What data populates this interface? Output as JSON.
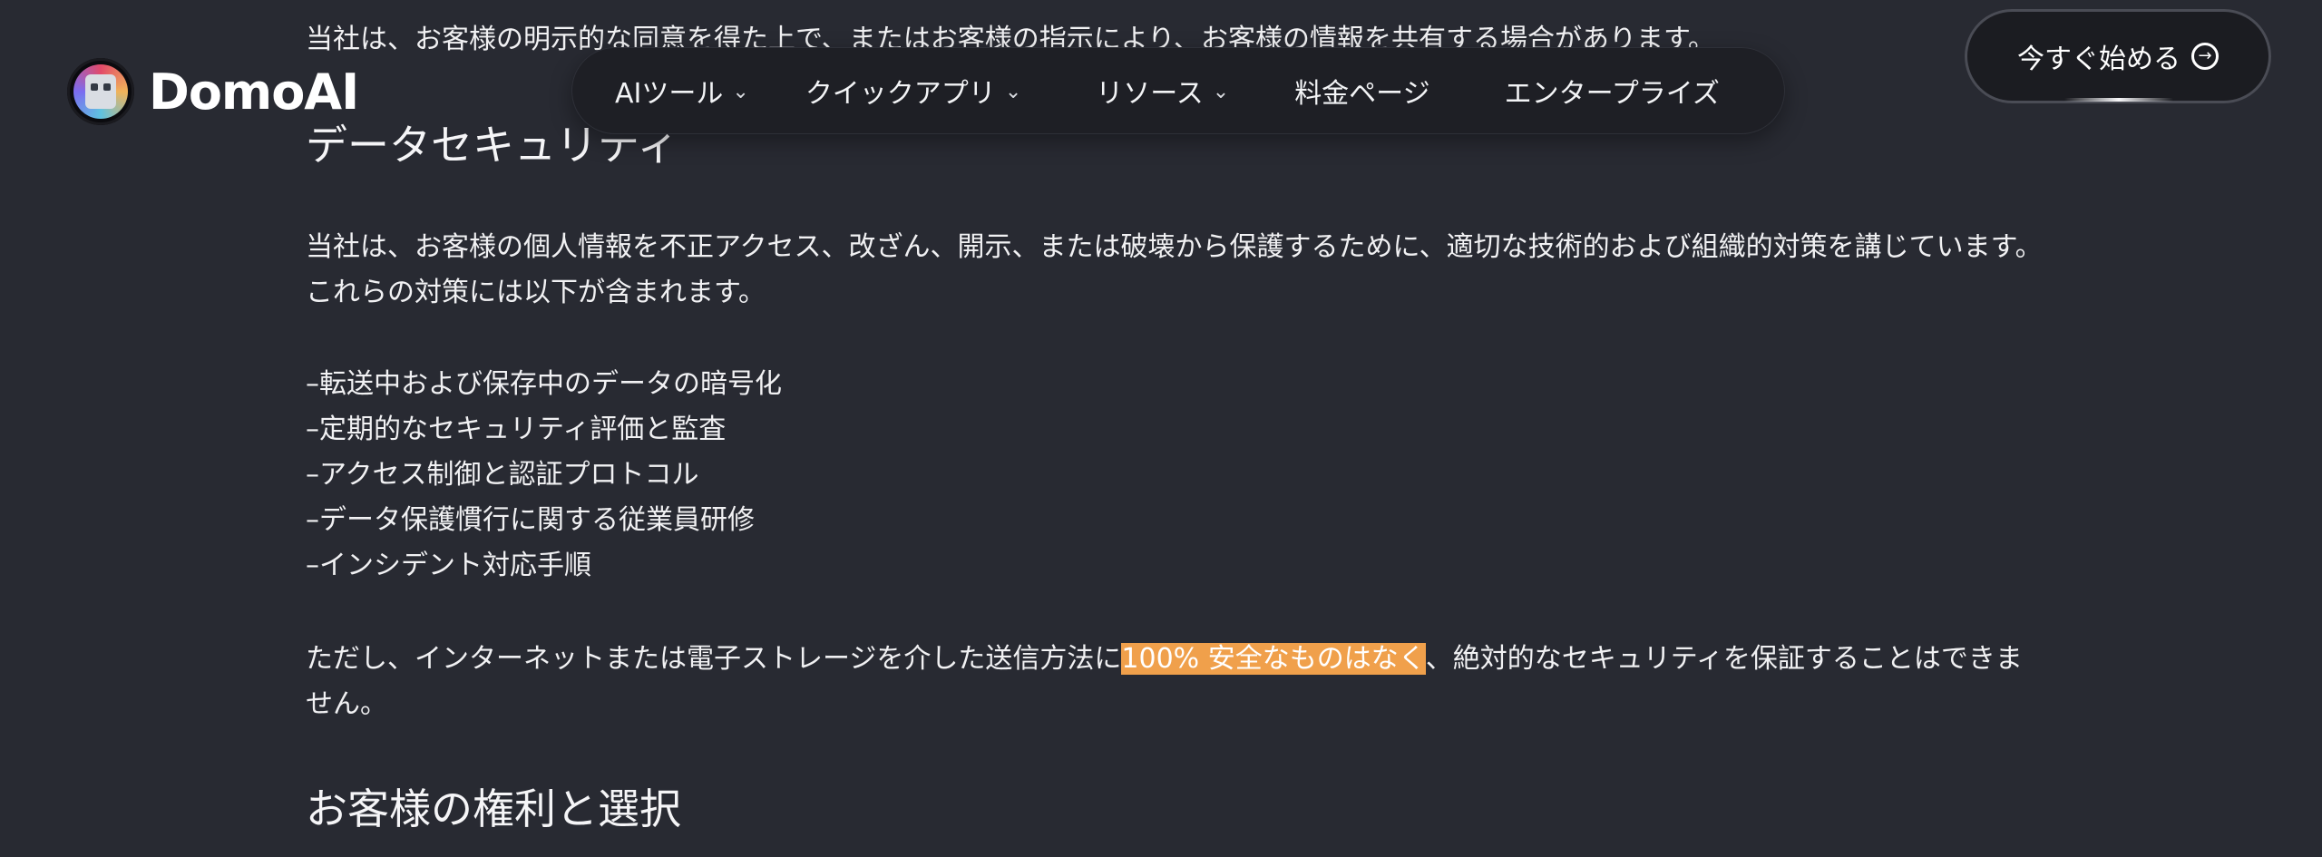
{
  "header": {
    "brand": "DomoAI",
    "nav": [
      {
        "label": "AIツール",
        "has_dropdown": true
      },
      {
        "label": "クイックアプリ",
        "has_dropdown": true
      },
      {
        "label": "リソース",
        "has_dropdown": true
      },
      {
        "label": "料金ページ",
        "has_dropdown": false
      },
      {
        "label": "エンタープライズ",
        "has_dropdown": false
      }
    ],
    "cta_label": "今すぐ始める",
    "cta_icon": "arrow-right-circle-icon"
  },
  "content": {
    "cut_off_line": "当社は、お客様の明示的な同意を得た上で、またはお客様の指示により、お客様の情報を共有する場合があります。",
    "security_heading": "データセキュリティ",
    "security_para": "当社は、お客様の個人情報を不正アクセス、改ざん、開示、または破壊から保護するために、適切な技術的および組織的対策を講じています。これらの対策には以下が含まれます。",
    "measures": [
      "–転送中および保存中のデータの暗号化",
      "–定期的なセキュリティ評価と監査",
      "–アクセス制御と認証プロトコル",
      "–データ保護慣行に関する従業員研修",
      "–インシデント対応手順"
    ],
    "disclaimer_before": "ただし、インターネットまたは電子ストレージを介した送信方法に",
    "disclaimer_highlight": "100% 安全なものはなく",
    "disclaimer_after": "、絶対的なセキュリティを保証することはできません。",
    "rights_heading": "お客様の権利と選択"
  },
  "colors": {
    "background": "#282a32",
    "nav_background": "#1e1f25",
    "highlight": "#f0a04b",
    "text": "#f3f4f6"
  }
}
